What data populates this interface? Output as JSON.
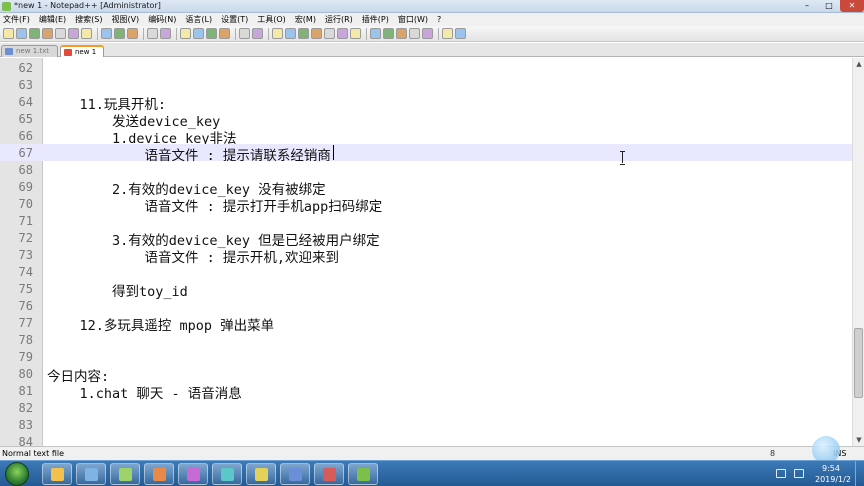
{
  "window": {
    "title": "*new 1 - Notepad++ [Administrator]",
    "controls": {
      "minimize": "–",
      "maximize": "□",
      "close": "✕"
    }
  },
  "menu": [
    "文件(F)",
    "编辑(E)",
    "搜索(S)",
    "视图(V)",
    "编码(N)",
    "语言(L)",
    "设置(T)",
    "工具(O)",
    "宏(M)",
    "运行(R)",
    "插件(P)",
    "窗口(W)",
    "?"
  ],
  "toolbar_icons": [
    "new-file",
    "open-file",
    "save",
    "save-all",
    "close",
    "close-all",
    "print",
    "cut",
    "copy",
    "paste",
    "undo",
    "redo",
    "find",
    "replace",
    "zoom-in",
    "zoom-out",
    "sync-v",
    "sync-h",
    "word-wrap",
    "show-all",
    "indent-guide",
    "udl",
    "doc-map",
    "function-list",
    "folder",
    "monitor",
    "record",
    "stop",
    "play",
    "play-multi",
    "save-macro",
    "spell-check"
  ],
  "tabs": [
    {
      "label": "new 1.txt",
      "active": false
    },
    {
      "label": "new 1",
      "active": true
    }
  ],
  "editor": {
    "lines": [
      {
        "num": "62",
        "text": ""
      },
      {
        "num": "63",
        "text": ""
      },
      {
        "num": "64",
        "text": "    11.玩具开机:"
      },
      {
        "num": "65",
        "text": "        发送device_key"
      },
      {
        "num": "66",
        "text": "        1.device_key非法"
      },
      {
        "num": "67",
        "text": "            语音文件 : 提示请联系经销商"
      },
      {
        "num": "68",
        "text": ""
      },
      {
        "num": "69",
        "text": "        2.有效的device_key 没有被绑定"
      },
      {
        "num": "70",
        "text": "            语音文件 : 提示打开手机app扫码绑定"
      },
      {
        "num": "71",
        "text": ""
      },
      {
        "num": "72",
        "text": "        3.有效的device_key 但是已经被用户绑定"
      },
      {
        "num": "73",
        "text": "            语音文件 : 提示开机,欢迎来到"
      },
      {
        "num": "74",
        "text": ""
      },
      {
        "num": "75",
        "text": "        得到toy_id"
      },
      {
        "num": "76",
        "text": ""
      },
      {
        "num": "77",
        "text": "    12.多玩具遥控 mpop 弹出菜单"
      },
      {
        "num": "78",
        "text": ""
      },
      {
        "num": "79",
        "text": ""
      },
      {
        "num": "80",
        "text": "今日内容:"
      },
      {
        "num": "81",
        "text": "    1.chat 聊天 - 语音消息"
      },
      {
        "num": "82",
        "text": ""
      },
      {
        "num": "83",
        "text": ""
      },
      {
        "num": "84",
        "text": ""
      }
    ],
    "current_line": "67"
  },
  "status": {
    "file_type": "Normal text file",
    "position": "8",
    "mode": "INS"
  },
  "taskbar": {
    "clock_time": "9:54",
    "clock_date": "2019/1/2"
  },
  "colors": {
    "current_line_bg": "#e8e8ff",
    "gutter_bg": "#e4e4e4",
    "active_tab_accent": "#f59a23",
    "taskbar_bg": "#245a93"
  }
}
